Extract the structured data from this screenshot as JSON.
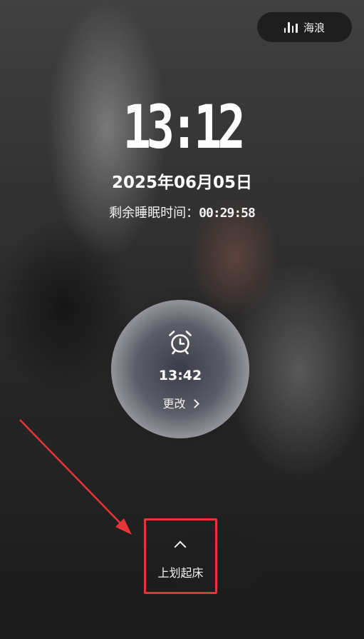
{
  "top_chip": {
    "label": "海浪",
    "icon": "bar-chart-icon"
  },
  "clock": {
    "time": "13:12",
    "date": "2025年06月05日",
    "remaining_label": "剩余睡眠时间：",
    "remaining_value": "00:29:58"
  },
  "alarm": {
    "icon": "alarm-clock-icon",
    "time": "13:42",
    "change_label": "更改"
  },
  "swipe": {
    "icon": "chevron-up-icon",
    "label": "上划起床"
  },
  "colors": {
    "annotation": "#e53535",
    "chip_bg": "#191919"
  }
}
